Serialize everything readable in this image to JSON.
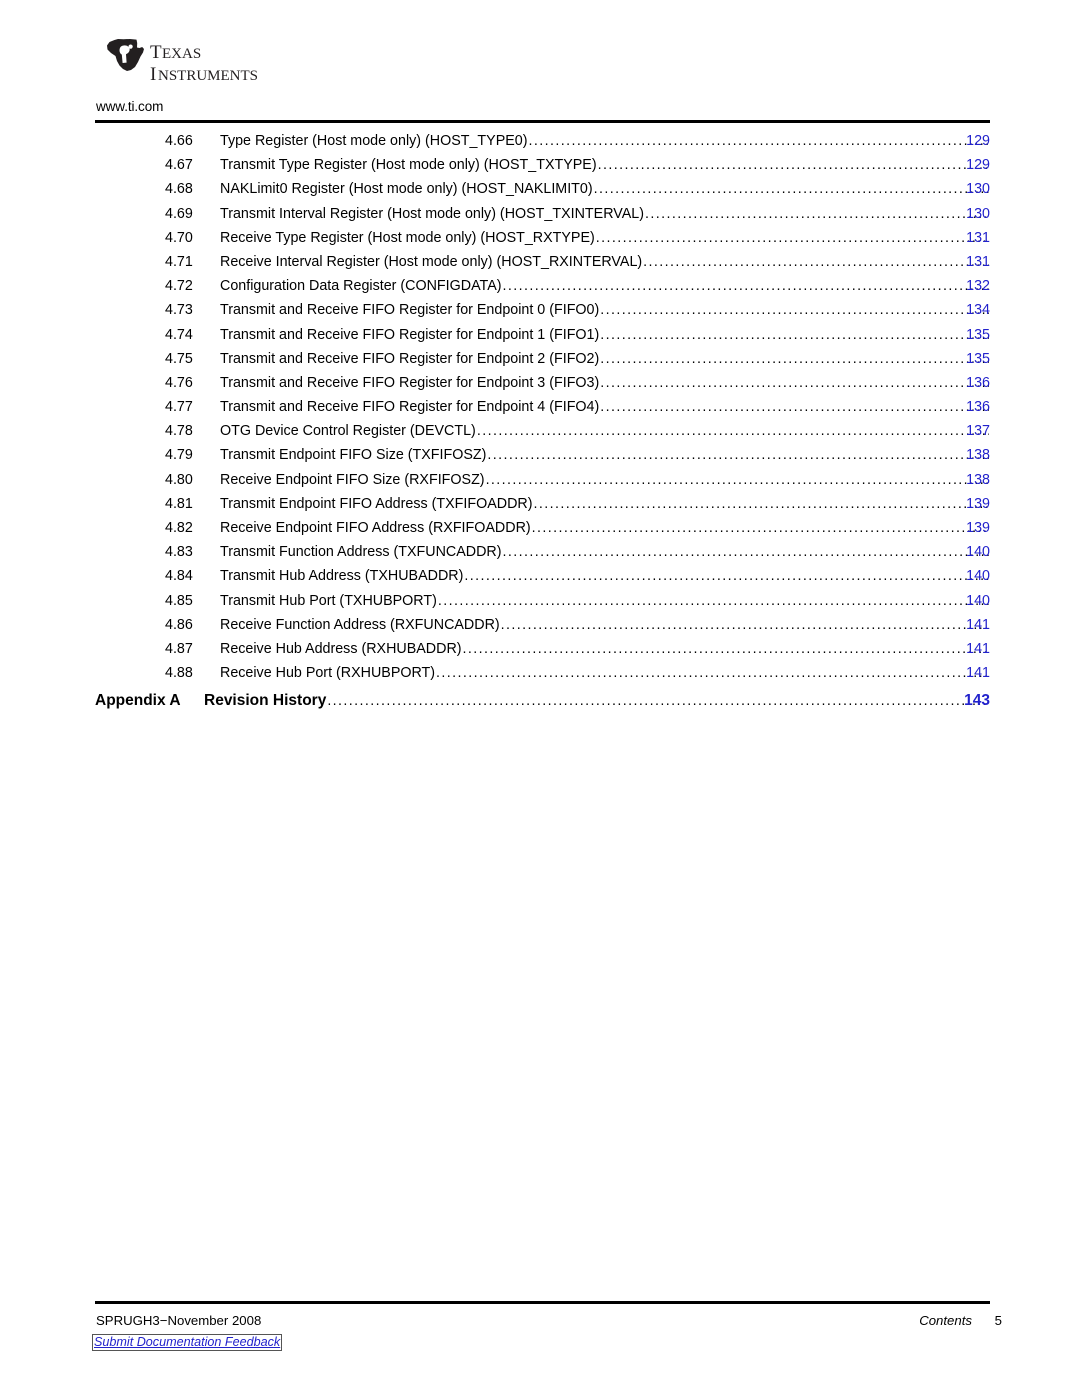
{
  "header": {
    "logo_line1": "TEXAS",
    "logo_line2": "INSTRUMENTS",
    "logo_mark": "ti-texas-logo",
    "site_url": "www.ti.com"
  },
  "toc": {
    "leader": "............................................................................................................................",
    "entries": [
      {
        "number": "4.66",
        "title": "Type Register (Host mode only) (HOST_TYPE0)",
        "page": "129"
      },
      {
        "number": "4.67",
        "title": "Transmit Type Register (Host mode only) (HOST_TXTYPE)",
        "page": "129"
      },
      {
        "number": "4.68",
        "title": "NAKLimit0 Register (Host mode only) (HOST_NAKLIMIT0)",
        "page": "130"
      },
      {
        "number": "4.69",
        "title": "Transmit Interval Register (Host mode only) (HOST_TXINTERVAL)",
        "page": "130"
      },
      {
        "number": "4.70",
        "title": "Receive Type Register (Host mode only) (HOST_RXTYPE)",
        "page": "131"
      },
      {
        "number": "4.71",
        "title": "Receive Interval Register (Host mode only) (HOST_RXINTERVAL)",
        "page": "131"
      },
      {
        "number": "4.72",
        "title": "Configuration Data Register (CONFIGDATA)",
        "page": "132"
      },
      {
        "number": "4.73",
        "title": "Transmit and Receive FIFO Register for Endpoint 0 (FIFO0)",
        "page": "134"
      },
      {
        "number": "4.74",
        "title": "Transmit and Receive FIFO Register for Endpoint 1 (FIFO1)",
        "page": "135"
      },
      {
        "number": "4.75",
        "title": "Transmit and Receive FIFO Register for Endpoint 2 (FIFO2)",
        "page": "135"
      },
      {
        "number": "4.76",
        "title": "Transmit and Receive FIFO Register for Endpoint 3 (FIFO3)",
        "page": "136"
      },
      {
        "number": "4.77",
        "title": "Transmit and Receive FIFO Register for Endpoint 4 (FIFO4)",
        "page": "136"
      },
      {
        "number": "4.78",
        "title": "OTG Device Control Register (DEVCTL)",
        "page": "137"
      },
      {
        "number": "4.79",
        "title": "Transmit Endpoint FIFO Size (TXFIFOSZ)",
        "page": "138"
      },
      {
        "number": "4.80",
        "title": "Receive Endpoint FIFO Size (RXFIFOSZ)",
        "page": "138"
      },
      {
        "number": "4.81",
        "title": "Transmit Endpoint FIFO Address (TXFIFOADDR)",
        "page": "139"
      },
      {
        "number": "4.82",
        "title": "Receive Endpoint FIFO Address (RXFIFOADDR)",
        "page": "139"
      },
      {
        "number": "4.83",
        "title": "Transmit Function Address (TXFUNCADDR)",
        "page": "140"
      },
      {
        "number": "4.84",
        "title": "Transmit Hub Address (TXHUBADDR)",
        "page": "140"
      },
      {
        "number": "4.85",
        "title": "Transmit Hub Port (TXHUBPORT)",
        "page": "140"
      },
      {
        "number": "4.86",
        "title": "Receive Function Address (RXFUNCADDR)",
        "page": "141"
      },
      {
        "number": "4.87",
        "title": "Receive Hub Address (RXHUBADDR)",
        "page": "141"
      },
      {
        "number": "4.88",
        "title": "Receive Hub Port (RXHUBPORT)",
        "page": "141"
      }
    ],
    "appendix": {
      "label": "Appendix A",
      "title": "Revision History",
      "page": "143"
    }
  },
  "footer": {
    "doc_id": "SPRUGH3−November 2008",
    "feedback_link": "Submit Documentation Feedback",
    "section": "Contents",
    "page_number": "5"
  },
  "colors": {
    "page_link": "#2222cc",
    "text": "#000000",
    "rule": "#000000"
  }
}
